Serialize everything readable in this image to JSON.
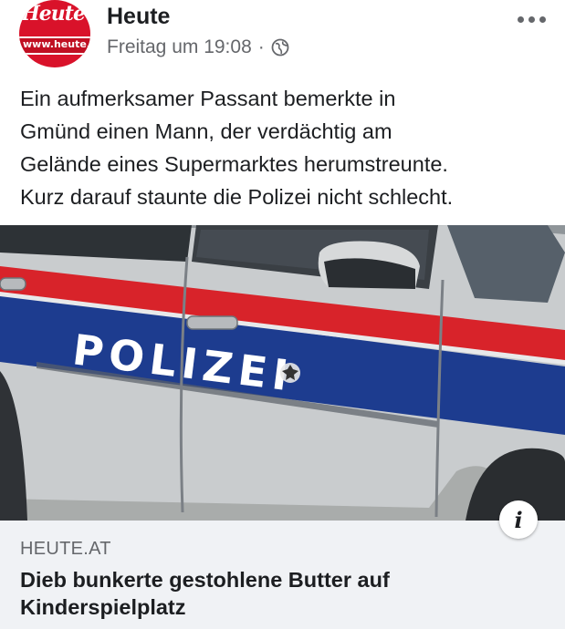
{
  "page": {
    "name": "Heute",
    "avatar_logo_text": "Heute",
    "avatar_logo_url": "www.heute.at",
    "timestamp": "Freitag um 19:08",
    "separator": "·",
    "privacy_icon": "globe-icon",
    "more_icon": "more-options-icon"
  },
  "post": {
    "text_lines": [
      "Ein aufmerksamer Passant bemerkte in",
      "Gmünd einen Mann, der verdächtig am",
      "Gelände eines Supermarktes herumstreunte.",
      "Kurz darauf staunte die Polizei nicht schlecht."
    ]
  },
  "preview": {
    "image_text": "POLIZEI",
    "info_icon": "info-icon",
    "info_label": "i"
  },
  "link": {
    "domain": "HEUTE.AT",
    "title": "Dieb bunkerte gestohlene Butter auf Kinderspielplatz"
  },
  "colors": {
    "brand_red": "#d9122a",
    "police_blue": "#1d3c8f",
    "police_red": "#d8232a",
    "car_silver": "#c9ccce",
    "caption_bg": "#f0f2f5"
  }
}
